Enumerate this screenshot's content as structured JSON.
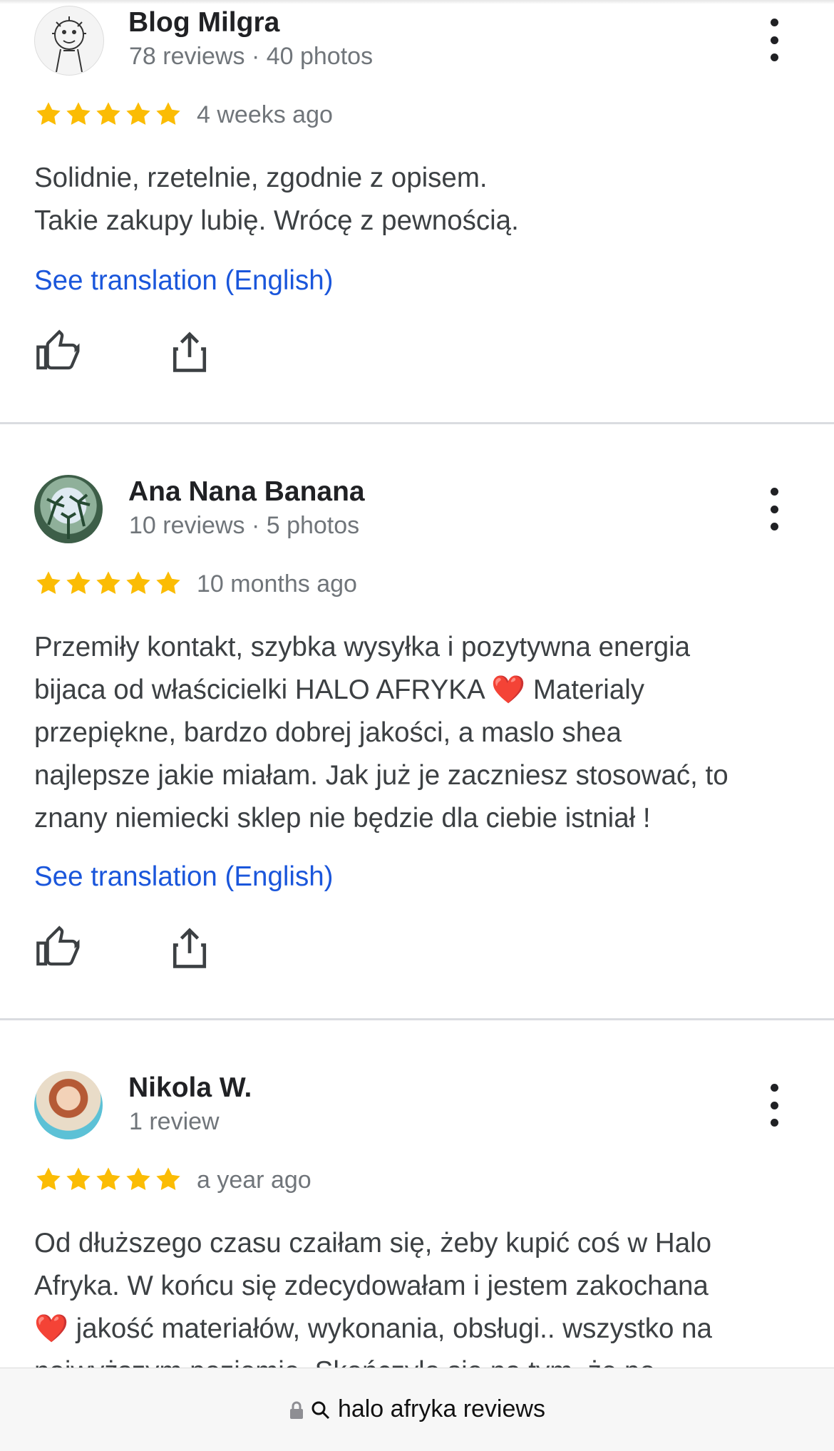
{
  "reviews": [
    {
      "name": "Blog Milgra",
      "meta": "78 reviews · 40 photos",
      "rating": 5,
      "date": "4 weeks ago",
      "text": "Solidnie, rzetelnie, zgodnie z opisem.\nTakie zakupy lubię. Wrócę z pewnością.",
      "translate_label": "See translation (English)"
    },
    {
      "name": "Ana Nana Banana",
      "meta": "10 reviews · 5 photos",
      "rating": 5,
      "date": "10 months ago",
      "text": "Przemiły kontakt, szybka wysyłka i pozytywna energia\nbijaca od właścicielki HALO AFRYKA ❤️ Materialy\nprzepiękne, bardzo dobrej jakości, a maslo shea\nnajlepsze jakie miałam. Jak już je zaczniesz stosować, to\nznany niemiecki sklep nie będzie dla ciebie istniał !",
      "translate_label": "See translation (English)"
    },
    {
      "name": "Nikola W.",
      "meta": "1 review",
      "rating": 5,
      "date": "a year ago",
      "text": "Od dłuższego czasu czaiłam się, żeby kupić coś w Halo\nAfryka. W końcu się zdecydowałam i jestem zakochana\n❤️ jakość materiałów, wykonania, obsługi.. wszystko na\nnajwyższym poziomie. Skończyło się na tym, że po"
    }
  ],
  "address_bar": {
    "text": "halo afryka reviews"
  },
  "colors": {
    "star": "#fbbc04",
    "link": "#1a56db",
    "meta": "#70757a"
  }
}
